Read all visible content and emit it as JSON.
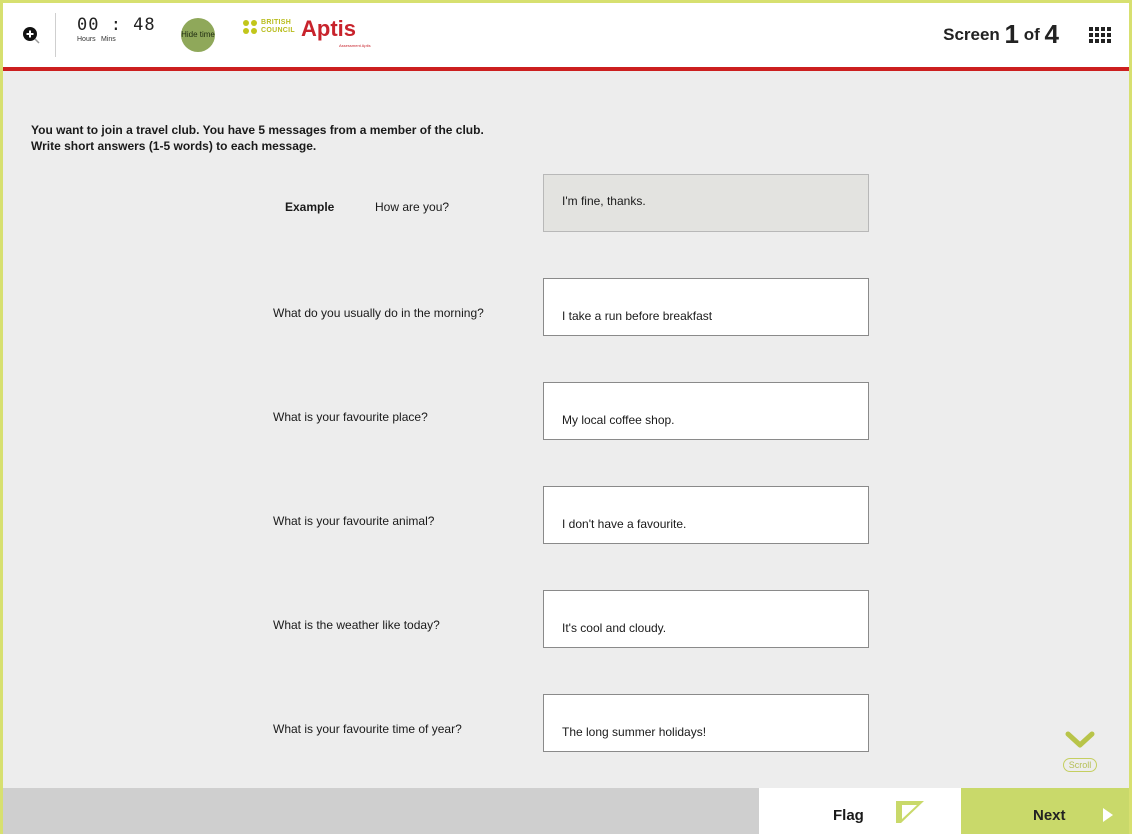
{
  "header": {
    "timer": {
      "value": "00 : 48",
      "hours_label": "Hours",
      "mins_label": "Mins"
    },
    "hide_time_label": "Hide time",
    "logo": {
      "org_line1": "BRITISH",
      "org_line2": "COUNCIL",
      "product": "Aptis",
      "tagline": "Assessment Aptis"
    },
    "screen": {
      "prefix": "Screen",
      "current": "1",
      "of": "of",
      "total": "4"
    },
    "icons": {
      "zoom": "zoom-in-icon",
      "menu": "grid-menu-icon"
    }
  },
  "instructions": {
    "line1": "You want to join a travel club. You have 5 messages from a member of the club.",
    "line2": "Write short answers (1-5 words) to each message."
  },
  "example": {
    "label": "Example",
    "question": "How are you?",
    "answer": "I'm fine, thanks."
  },
  "questions": [
    {
      "question": "What do you usually do in the morning?",
      "answer": "I take a run before breakfast"
    },
    {
      "question": "What is your favourite place?",
      "answer": "My local coffee shop."
    },
    {
      "question": "What is your favourite animal?",
      "answer": "I don't have a favourite."
    },
    {
      "question": "What is the weather like today?",
      "answer": "It's cool and cloudy."
    },
    {
      "question": "What is your favourite time of year?",
      "answer": "The long summer holidays!"
    }
  ],
  "scroll": {
    "label": "Scroll",
    "icon": "chevron-down-icon"
  },
  "footer": {
    "flag_label": "Flag",
    "flag_icon": "flag-icon",
    "next_label": "Next",
    "next_icon": "play-right-icon"
  },
  "colors": {
    "accent_green": "#c9d96a",
    "brand_red": "#cc1f1f",
    "hide_time_green": "#8fa85a"
  }
}
